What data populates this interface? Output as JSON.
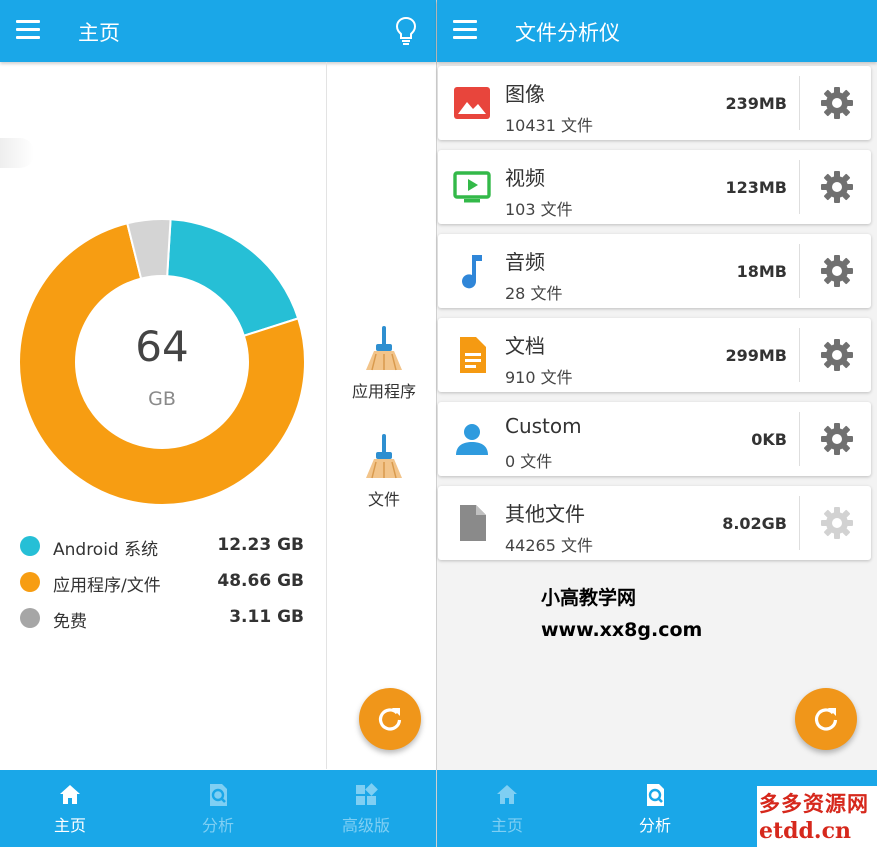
{
  "colors": {
    "primary": "#1aa7e8",
    "accent": "#f0961a",
    "android_segment": "#26bfd6",
    "apps_segment": "#f79d12",
    "free_segment": "#d4d4d4"
  },
  "left": {
    "title": "主页",
    "storage": {
      "total_number": "64",
      "total_unit": "GB",
      "segments": [
        {
          "name": "Android 系统",
          "value_label": "12.23 GB",
          "gb": 12.23
        },
        {
          "name": "应用程序/文件",
          "value_label": "48.66 GB",
          "gb": 48.66
        },
        {
          "name": "免费",
          "value_label": "3.11 GB",
          "gb": 3.11
        }
      ]
    },
    "cleaners": [
      {
        "label": "应用程序"
      },
      {
        "label": "文件"
      }
    ],
    "nav": [
      {
        "label": "主页",
        "active": true,
        "icon": "home-icon"
      },
      {
        "label": "分析",
        "active": false,
        "icon": "analysis-icon"
      },
      {
        "label": "高级版",
        "active": false,
        "icon": "premium-grid-icon"
      }
    ]
  },
  "right": {
    "title": "文件分析仪",
    "categories": [
      {
        "name": "图像",
        "count": "10431 文件",
        "size": "239MB",
        "icon": "image-icon"
      },
      {
        "name": "视频",
        "count": "103 文件",
        "size": "123MB",
        "icon": "video-icon"
      },
      {
        "name": "音频",
        "count": "28 文件",
        "size": "18MB",
        "icon": "music-note-icon"
      },
      {
        "name": "文档",
        "count": "910 文件",
        "size": "299MB",
        "icon": "document-icon"
      },
      {
        "name": "Custom",
        "count": "0 文件",
        "size": "0KB",
        "icon": "person-icon"
      },
      {
        "name": "其他文件",
        "count": "44265 文件",
        "size": "8.02GB",
        "icon": "file-icon"
      }
    ],
    "nav": [
      {
        "label": "主页",
        "active": false,
        "icon": "home-icon"
      },
      {
        "label": "分析",
        "active": true,
        "icon": "analysis-icon"
      }
    ]
  },
  "watermark": {
    "site_name": "小高教学网",
    "site_url": "www.xx8g.com",
    "corner_line1": "多多资源网",
    "corner_line2": "etdd.cn"
  }
}
